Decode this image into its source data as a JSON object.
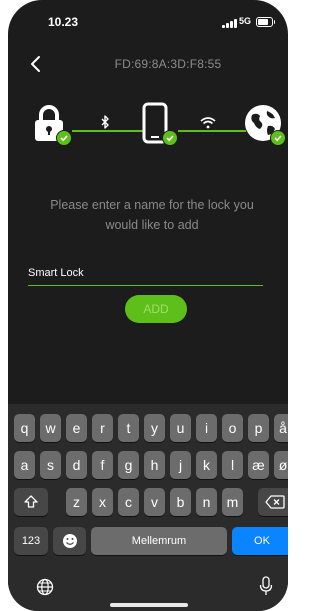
{
  "status_bar": {
    "time": "10.23",
    "network": "5G"
  },
  "header": {
    "title": "FD:69:8A:3D:F8:55"
  },
  "flow": {
    "steps": [
      "lock-icon",
      "phone-icon",
      "globe-icon"
    ],
    "connections": [
      "bluetooth-icon",
      "wifi-icon"
    ],
    "accent": "#5fbf1a"
  },
  "form": {
    "prompt": "Please enter a name for the lock you would like to add",
    "name_value": "Smart Lock",
    "add_label": "ADD"
  },
  "keyboard": {
    "row1": [
      "q",
      "w",
      "e",
      "r",
      "t",
      "y",
      "u",
      "i",
      "o",
      "p",
      "å"
    ],
    "row2": [
      "a",
      "s",
      "d",
      "f",
      "g",
      "h",
      "j",
      "k",
      "l",
      "æ",
      "ø"
    ],
    "row3": [
      "z",
      "x",
      "c",
      "v",
      "b",
      "n",
      "m"
    ],
    "numbers_label": "123",
    "space_label": "Mellemrum",
    "return_label": "OK"
  }
}
